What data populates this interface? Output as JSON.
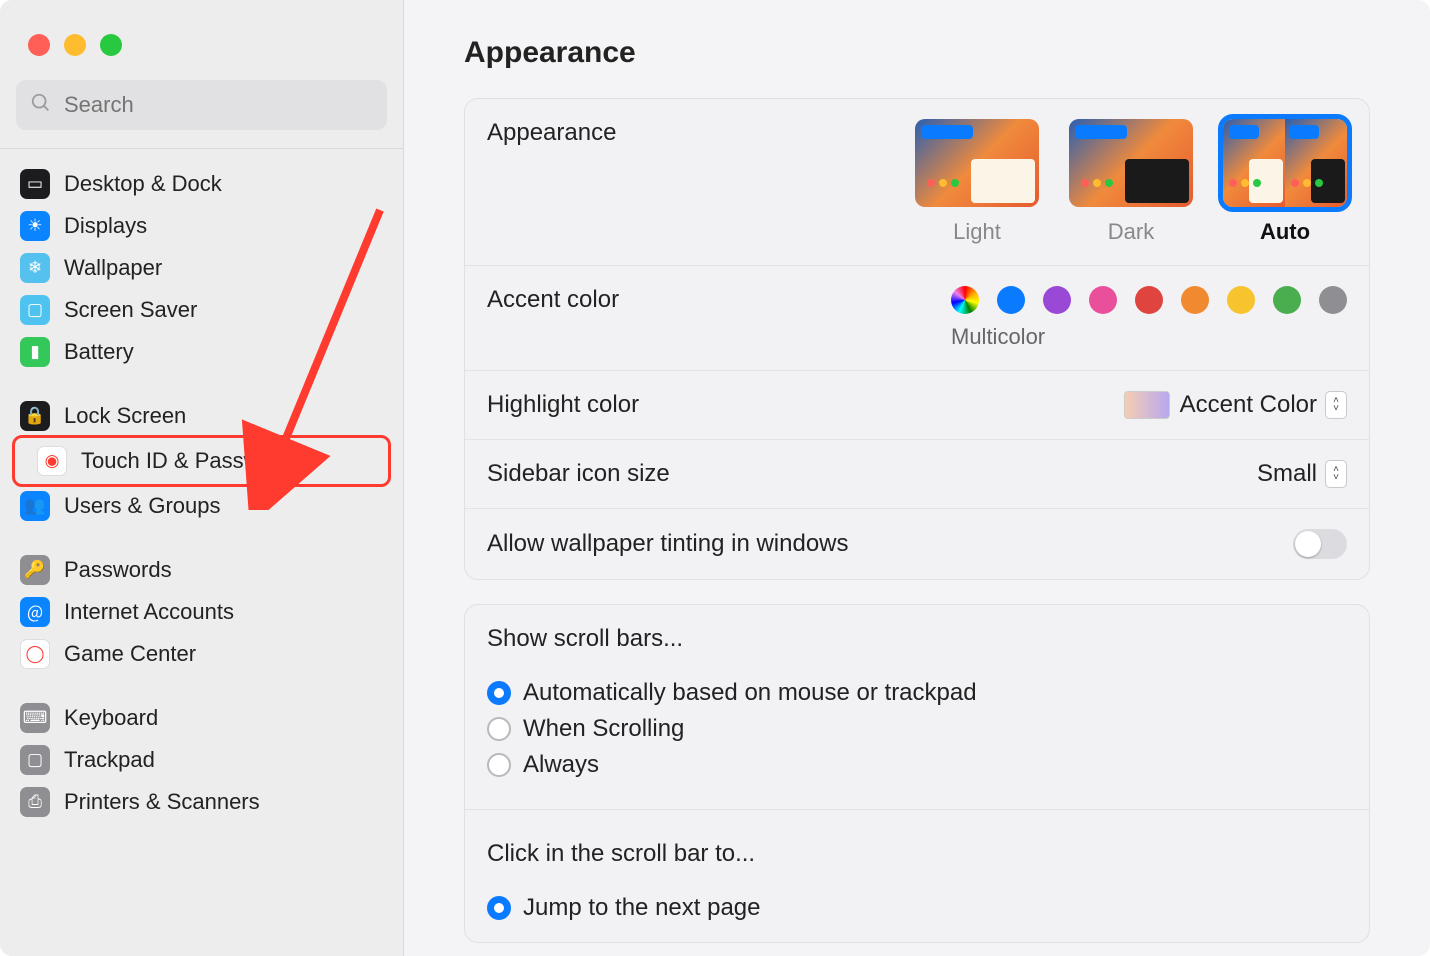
{
  "search": {
    "placeholder": "Search"
  },
  "traffic": {
    "close": "close",
    "min": "minimize",
    "max": "maximize"
  },
  "sidebar": {
    "groups": [
      [
        {
          "label": "Desktop & Dock",
          "name": "desktop-dock",
          "iconBg": "#1c1c1e"
        },
        {
          "label": "Displays",
          "name": "displays",
          "iconBg": "#0a84ff"
        },
        {
          "label": "Wallpaper",
          "name": "wallpaper",
          "iconBg": "#55c1ef"
        },
        {
          "label": "Screen Saver",
          "name": "screen-saver",
          "iconBg": "#4fc3ef"
        },
        {
          "label": "Battery",
          "name": "battery",
          "iconBg": "#34c759"
        }
      ],
      [
        {
          "label": "Lock Screen",
          "name": "lock-screen",
          "iconBg": "#1c1c1e"
        },
        {
          "label": "Touch ID & Password",
          "name": "touch-id-password",
          "iconBg": "#ffffff",
          "highlighted": true
        },
        {
          "label": "Users & Groups",
          "name": "users-groups",
          "iconBg": "#0a84ff"
        }
      ],
      [
        {
          "label": "Passwords",
          "name": "passwords",
          "iconBg": "#8e8e93"
        },
        {
          "label": "Internet Accounts",
          "name": "internet-accounts",
          "iconBg": "#0a84ff"
        },
        {
          "label": "Game Center",
          "name": "game-center",
          "iconBg": "#ffffff"
        }
      ],
      [
        {
          "label": "Keyboard",
          "name": "keyboard",
          "iconBg": "#8e8e93"
        },
        {
          "label": "Trackpad",
          "name": "trackpad",
          "iconBg": "#8e8e93"
        },
        {
          "label": "Printers & Scanners",
          "name": "printers-scanners",
          "iconBg": "#8e8e93"
        }
      ]
    ]
  },
  "page": {
    "title": "Appearance",
    "appearance": {
      "label": "Appearance",
      "options": [
        {
          "label": "Light",
          "name": "light"
        },
        {
          "label": "Dark",
          "name": "dark"
        },
        {
          "label": "Auto",
          "name": "auto",
          "selected": true
        }
      ]
    },
    "accent": {
      "label": "Accent color",
      "selected_label": "Multicolor",
      "colors": [
        "multi",
        "#0a7aff",
        "#9a48d6",
        "#e94f9a",
        "#e0443e",
        "#f0892f",
        "#f7c32e",
        "#4aae4f",
        "#8e8e93"
      ]
    },
    "highlight": {
      "label": "Highlight color",
      "value": "Accent Color"
    },
    "sidebar_icon": {
      "label": "Sidebar icon size",
      "value": "Small"
    },
    "tint": {
      "label": "Allow wallpaper tinting in windows",
      "value": false
    },
    "scroll": {
      "heading": "Show scroll bars...",
      "options": [
        {
          "label": "Automatically based on mouse or trackpad",
          "checked": true
        },
        {
          "label": "When Scrolling",
          "checked": false
        },
        {
          "label": "Always",
          "checked": false
        }
      ]
    },
    "click_scroll": {
      "heading": "Click in the scroll bar to...",
      "options": [
        {
          "label": "Jump to the next page",
          "checked": true
        }
      ]
    }
  }
}
